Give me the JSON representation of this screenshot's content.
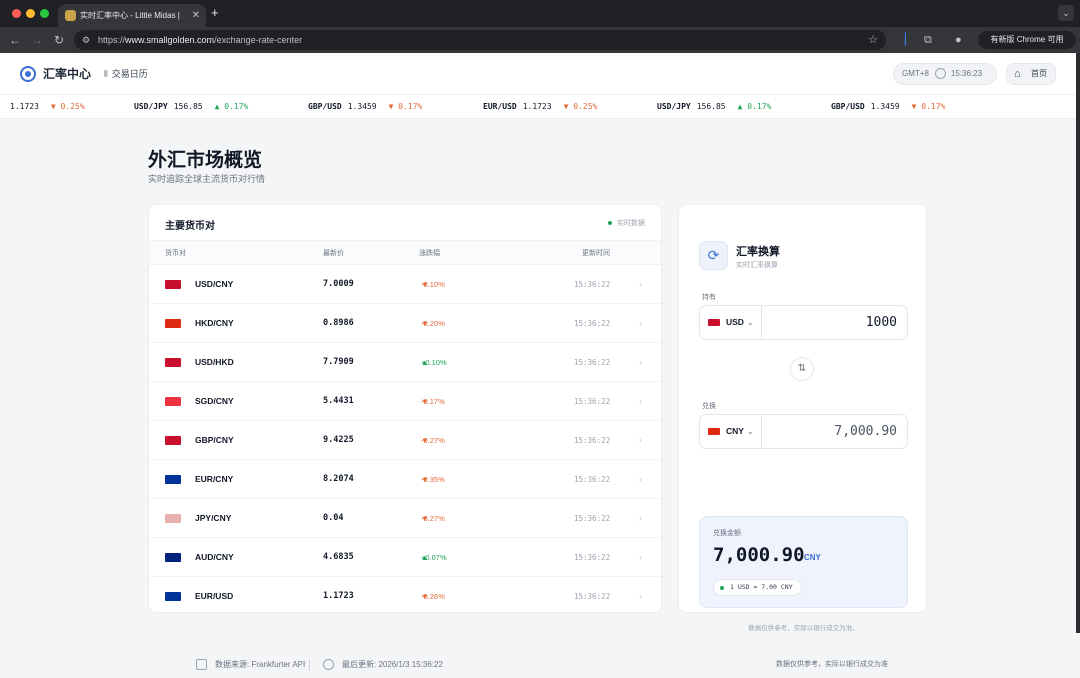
{
  "browser": {
    "tab_title": "实时汇率中心 - Little Midas |",
    "url_scheme": "https://",
    "url_host": "www.smallgolden.com",
    "url_path": "/exchange-rate-center",
    "update_label": "有新版 Chrome 可用"
  },
  "header": {
    "brand": "汇率中心",
    "nav_label": "交易日历",
    "timezone": "GMT+8",
    "clock": "15:36:23",
    "home_label": "首页"
  },
  "ticker": [
    {
      "pair": "",
      "rate": "1.1723",
      "change": "0.25%",
      "dir": "down"
    },
    {
      "pair": "USD/JPY",
      "rate": "156.85",
      "change": "0.17%",
      "dir": "up"
    },
    {
      "pair": "GBP/USD",
      "rate": "1.3459",
      "change": "0.17%",
      "dir": "down"
    },
    {
      "pair": "EUR/USD",
      "rate": "1.1723",
      "change": "0.25%",
      "dir": "down"
    },
    {
      "pair": "USD/JPY",
      "rate": "156.85",
      "change": "0.17%",
      "dir": "up"
    },
    {
      "pair": "GBP/USD",
      "rate": "1.3459",
      "change": "0.17%",
      "dir": "down"
    }
  ],
  "page": {
    "title": "外汇市场概览",
    "subtitle": "实时追踪全球主流货币对行情"
  },
  "table": {
    "title": "主要货币对",
    "live_label": "实时数据",
    "columns": [
      "货币对",
      "最新价",
      "涨跌幅",
      "更新时间"
    ],
    "rows": [
      {
        "pair": "USD/CNY",
        "price": "7.0009",
        "change": "-0.10%",
        "dir": "down",
        "time": "15:36:22",
        "flag": "#c8102e"
      },
      {
        "pair": "HKD/CNY",
        "price": "0.8986",
        "change": "-0.20%",
        "dir": "down",
        "time": "15:36:22",
        "flag": "#de2910"
      },
      {
        "pair": "USD/HKD",
        "price": "7.7909",
        "change": "+0.10%",
        "dir": "up",
        "time": "15:36:22",
        "flag": "#c8102e"
      },
      {
        "pair": "SGD/CNY",
        "price": "5.4431",
        "change": "-0.17%",
        "dir": "down",
        "time": "15:36:22",
        "flag": "#ef3340"
      },
      {
        "pair": "GBP/CNY",
        "price": "9.4225",
        "change": "-0.27%",
        "dir": "down",
        "time": "15:36:22",
        "flag": "#c8102e"
      },
      {
        "pair": "EUR/CNY",
        "price": "8.2074",
        "change": "-0.35%",
        "dir": "down",
        "time": "15:36:22",
        "flag": "#003399"
      },
      {
        "pair": "JPY/CNY",
        "price": "0.04",
        "change": "-0.27%",
        "dir": "down",
        "time": "15:36:22",
        "flag": "#e9b0b0"
      },
      {
        "pair": "AUD/CNY",
        "price": "4.6835",
        "change": "+0.07%",
        "dir": "up",
        "time": "15:36:22",
        "flag": "#00247d"
      },
      {
        "pair": "EUR/USD",
        "price": "1.1723",
        "change": "-0.26%",
        "dir": "down",
        "time": "15:36:22",
        "flag": "#003399"
      }
    ]
  },
  "converter": {
    "title": "汇率换算",
    "subtitle": "实时汇率换算",
    "from_label": "持有",
    "from_currency": "USD",
    "from_amount": "1000",
    "to_label": "兑换",
    "to_currency": "CNY",
    "to_amount": "7,000.90",
    "result_label": "兑换金额",
    "result_value": "7,000.90",
    "result_currency": "CNY",
    "rate_text": "1 USD = 7.00 CNY",
    "note": "数据仅供参考，实际以银行成交为准。"
  },
  "footer": {
    "source": "数据来源: Frankfurter API",
    "updated": "最后更新: 2026/1/3 15:36:22",
    "disclaimer": "数据仅供参考，实际以银行成交为准"
  }
}
